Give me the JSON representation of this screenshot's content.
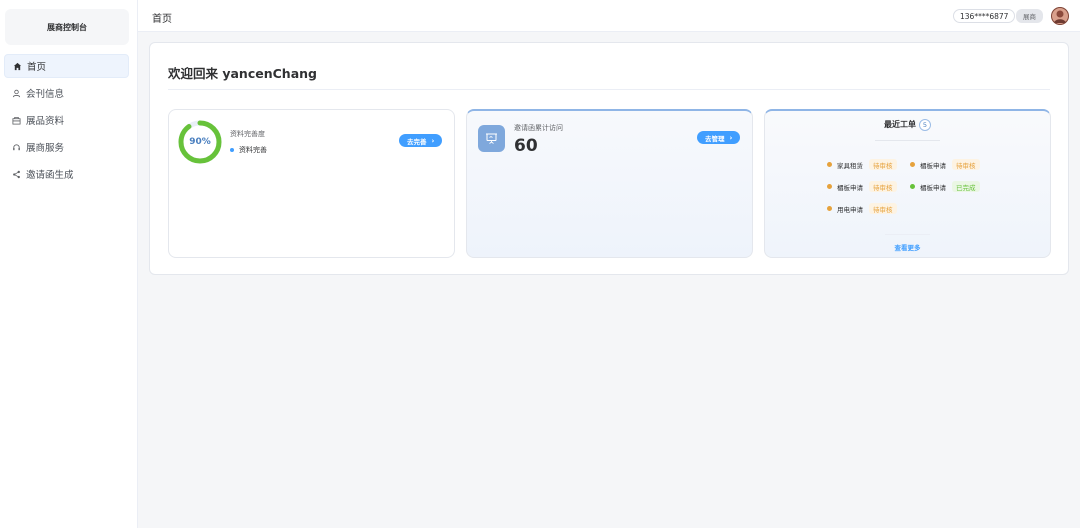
{
  "sidebar": {
    "title": "展商控制台",
    "items": [
      {
        "label": "首页",
        "icon": "home-icon",
        "active": true
      },
      {
        "label": "会刊信息",
        "icon": "user-icon",
        "active": false
      },
      {
        "label": "展品资料",
        "icon": "box-icon",
        "active": false
      },
      {
        "label": "展商服务",
        "icon": "service-icon",
        "active": false
      },
      {
        "label": "邀请函生成",
        "icon": "share-icon",
        "active": false
      }
    ]
  },
  "header": {
    "title": "首页",
    "phone": "136****6877",
    "role": "展商"
  },
  "main": {
    "welcome": "欢迎回来 yancenChang",
    "profile_card": {
      "percent_text": "90%",
      "percent": 0.9,
      "label": "资料完善度",
      "sub": "资料完善",
      "button": "去完善",
      "ring_color": "#67c23a"
    },
    "invite_card": {
      "label": "邀请函累计访问",
      "value": "60",
      "button": "去管理"
    },
    "orders_card": {
      "title": "最近工单",
      "count": "5",
      "orders": [
        {
          "name": "家具租赁",
          "status": "待审核",
          "state": "pending"
        },
        {
          "name": "楣板申请",
          "status": "待审核",
          "state": "pending"
        },
        {
          "name": "楣板申请",
          "status": "待审核",
          "state": "pending"
        },
        {
          "name": "楣板申请",
          "status": "已完成",
          "state": "done"
        },
        {
          "name": "用电申请",
          "status": "待审核",
          "state": "pending"
        }
      ],
      "more": "查看更多"
    }
  },
  "colors": {
    "accent": "#409eff",
    "pending": "#e6a23c",
    "done": "#67c23a"
  }
}
